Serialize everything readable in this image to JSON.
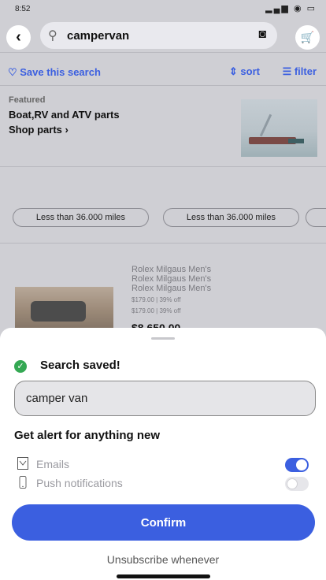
{
  "status_bar": {
    "time": "8:52",
    "icons": "▂▄▆ ◉ ▭"
  },
  "header": {
    "back_icon": "‹",
    "search_query": "campervan",
    "search_icon": "⚲",
    "camera_icon": "◙",
    "cart_icon": "🛒"
  },
  "actions": {
    "save_search": "♡ Save this search",
    "sort": "⇕ sort",
    "filter": "☰ filter"
  },
  "featured": {
    "tag": "Featured",
    "title": "Boat,RV and ATV parts",
    "shop": "Shop parts ›"
  },
  "chips": [
    "Less than 36.000 miles",
    "Less than 36.000 miles"
  ],
  "listing": {
    "titles": [
      "Rolex Milgaus Men's",
      "Rolex Milgaus Men's",
      "Rolex Milgaus Men's"
    ],
    "price_lines": [
      "$179.00 | 39% off",
      "$179.00 | 39% off"
    ],
    "price": "$8,650.00"
  },
  "sheet": {
    "saved_icon": "✓",
    "saved_title": "Search saved!",
    "name_value": "camper van",
    "alert_title": "Get alert for anything new",
    "options": [
      {
        "label": "Emails",
        "enabled": true
      },
      {
        "label": "Push notifications",
        "enabled": false
      }
    ],
    "confirm_label": "Confirm",
    "unsubscribe": "Unsubscribe whenever"
  },
  "colors": {
    "accent": "#3b5fe0",
    "success": "#34a853"
  }
}
